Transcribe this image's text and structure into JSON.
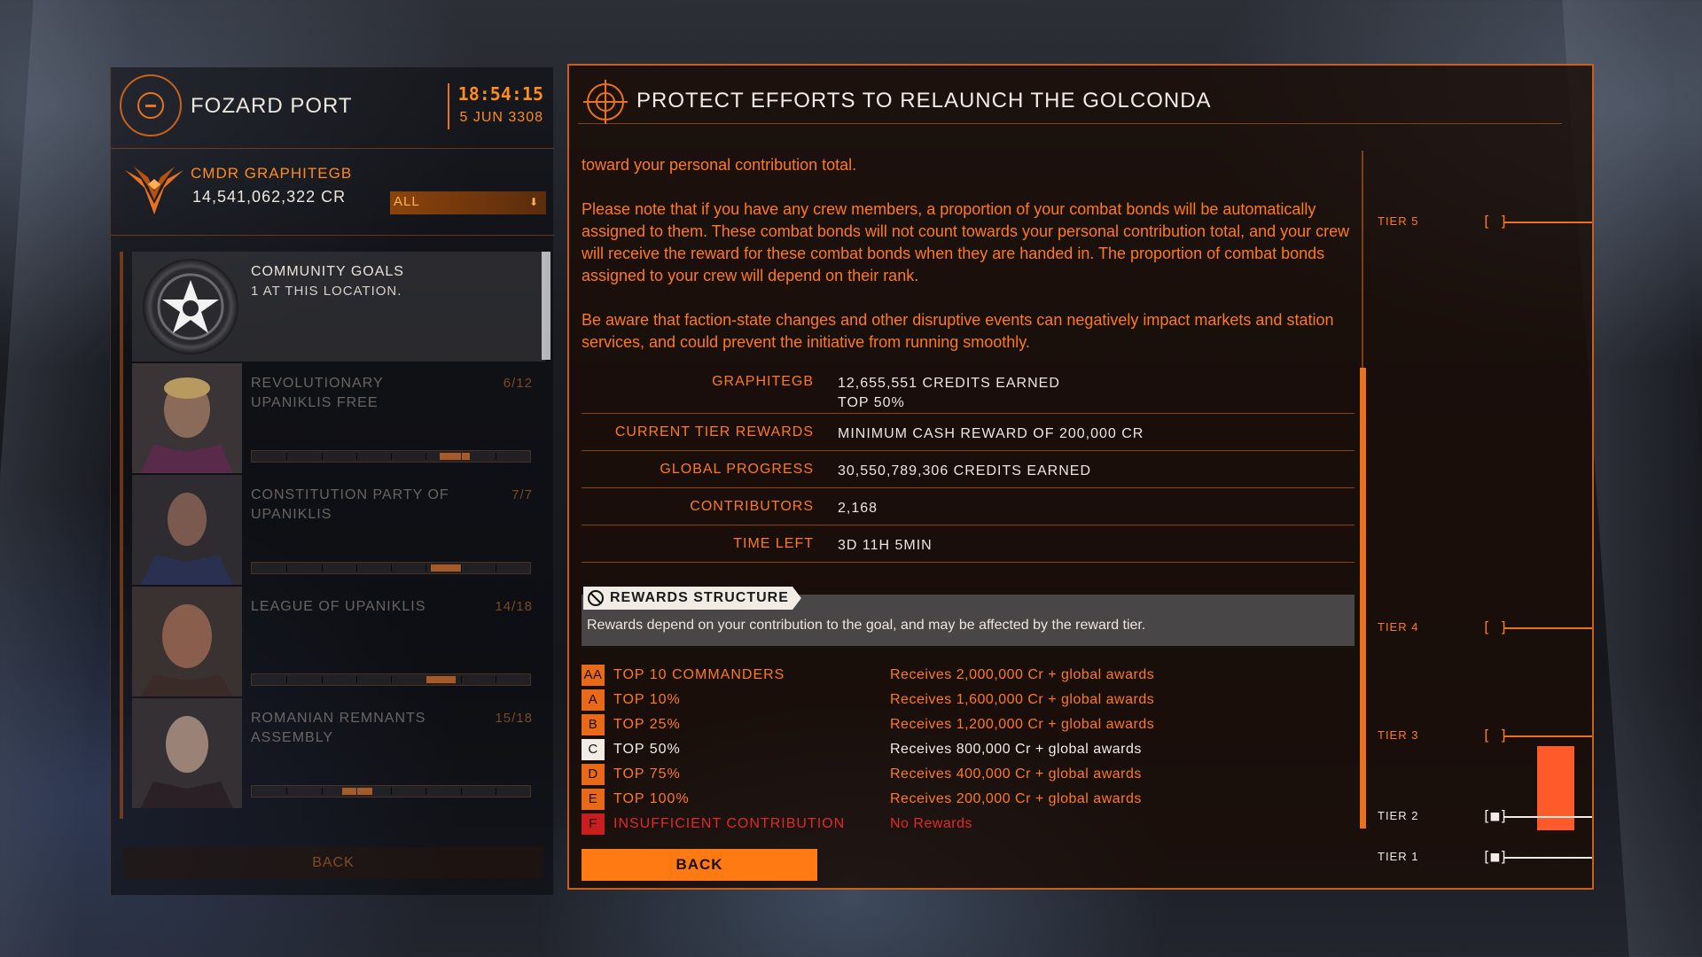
{
  "station": {
    "name": "FOZARD PORT",
    "time": "18:54:15",
    "date": "5 JUN 3308"
  },
  "commander": {
    "name": "CMDR GRAPHITEGB",
    "credits": "14,541,062,322 CR",
    "filter_value": "ALL"
  },
  "community_goals_item": {
    "title": "COMMUNITY GOALS",
    "subtitle": "1 AT THIS LOCATION."
  },
  "factions": [
    {
      "name": "REVOLUTIONARY UPANIKLIS FREE",
      "count": "6/12",
      "progress": 0.75
    },
    {
      "name": "CONSTITUTION PARTY OF UPANIKLIS",
      "count": "7/7",
      "progress": 0.72
    },
    {
      "name": "LEAGUE OF UPANIKLIS",
      "count": "14/18",
      "progress": 0.7
    },
    {
      "name": "ROMANIAN REMNANTS ASSEMBLY",
      "count": "15/18",
      "progress": 0.4
    }
  ],
  "left_back_label": "BACK",
  "goal": {
    "title": "PROTECT EFFORTS TO RELAUNCH THE GOLCONDA",
    "description": [
      "toward your personal contribution total.",
      "Please note that if you have any crew members, a proportion of your combat bonds will be automatically assigned to them. These combat bonds will not count towards your personal contribution total, and your crew will receive the reward for these combat bonds when they are handed in. The proportion of combat bonds assigned to your crew will depend on their rank.",
      "Be aware that faction-state changes and other disruptive events can negatively impact markets and station services, and could prevent the initiative from running smoothly."
    ],
    "stats": [
      {
        "label": "GRAPHITEGB",
        "value": "12,655,551 CREDITS EARNED",
        "value2": "TOP 50%"
      },
      {
        "label": "CURRENT TIER REWARDS",
        "value": "MINIMUM CASH REWARD OF 200,000 CR"
      },
      {
        "label": "GLOBAL PROGRESS",
        "value": "30,550,789,306 CREDITS EARNED"
      },
      {
        "label": "CONTRIBUTORS",
        "value": "2,168"
      },
      {
        "label": "TIME LEFT",
        "value": "3D 11H 5MIN"
      }
    ],
    "rewards_title": "REWARDS STRUCTURE",
    "rewards_note": "Rewards depend on your contribution to the goal, and may be affected by the reward tier.",
    "rewards": [
      {
        "grade": "AA",
        "bracket": "TOP 10 COMMANDERS",
        "reward": "Receives 2,000,000 Cr + global awards"
      },
      {
        "grade": "A",
        "bracket": "TOP 10%",
        "reward": "Receives 1,600,000 Cr + global awards"
      },
      {
        "grade": "B",
        "bracket": "TOP 25%",
        "reward": "Receives 1,200,000 Cr + global awards"
      },
      {
        "grade": "C",
        "bracket": "TOP 50%",
        "reward": "Receives 800,000 Cr + global awards"
      },
      {
        "grade": "D",
        "bracket": "TOP 75%",
        "reward": "Receives 400,000 Cr + global awards"
      },
      {
        "grade": "E",
        "bracket": "TOP 100%",
        "reward": "Receives 200,000 Cr + global awards"
      },
      {
        "grade": "F",
        "bracket": "INSUFFICIENT CONTRIBUTION",
        "reward": "No Rewards"
      }
    ],
    "current_grade": "C",
    "back_label": "BACK",
    "tiers": [
      {
        "label": "TIER 5",
        "mark": "[ ]",
        "reached": false
      },
      {
        "label": "TIER 4",
        "mark": "[ ]",
        "reached": false
      },
      {
        "label": "TIER 3",
        "mark": "[ ]",
        "reached": false
      },
      {
        "label": "TIER 2",
        "mark": "[■]",
        "reached": true
      },
      {
        "label": "TIER 1",
        "mark": "[■]",
        "reached": true
      }
    ],
    "tier_progress": 0.25
  },
  "colors": {
    "accent": "#ff7a1a",
    "current": "#f2ece4",
    "fail": "#e02a2a"
  }
}
